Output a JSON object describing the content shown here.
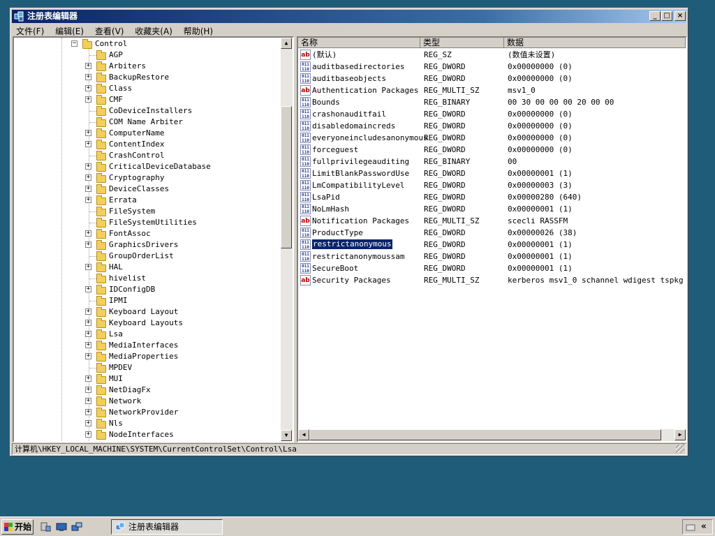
{
  "window": {
    "title": "注册表编辑器",
    "controls": {
      "minimize": "_",
      "maximize": "□",
      "close": "×"
    }
  },
  "menu": [
    "文件(F)",
    "编辑(E)",
    "查看(V)",
    "收藏夹(A)",
    "帮助(H)"
  ],
  "tree": {
    "parent": {
      "label": "Control",
      "expanded": true
    },
    "children": [
      {
        "label": "AGP",
        "expandable": false
      },
      {
        "label": "Arbiters",
        "expandable": true
      },
      {
        "label": "BackupRestore",
        "expandable": true
      },
      {
        "label": "Class",
        "expandable": true
      },
      {
        "label": "CMF",
        "expandable": true
      },
      {
        "label": "CoDeviceInstallers",
        "expandable": false
      },
      {
        "label": "COM Name Arbiter",
        "expandable": false
      },
      {
        "label": "ComputerName",
        "expandable": true
      },
      {
        "label": "ContentIndex",
        "expandable": true
      },
      {
        "label": "CrashControl",
        "expandable": false
      },
      {
        "label": "CriticalDeviceDatabase",
        "expandable": true
      },
      {
        "label": "Cryptography",
        "expandable": true
      },
      {
        "label": "DeviceClasses",
        "expandable": true
      },
      {
        "label": "Errata",
        "expandable": true
      },
      {
        "label": "FileSystem",
        "expandable": false
      },
      {
        "label": "FileSystemUtilities",
        "expandable": false
      },
      {
        "label": "FontAssoc",
        "expandable": true
      },
      {
        "label": "GraphicsDrivers",
        "expandable": true
      },
      {
        "label": "GroupOrderList",
        "expandable": false
      },
      {
        "label": "HAL",
        "expandable": true
      },
      {
        "label": "hivelist",
        "expandable": false
      },
      {
        "label": "IDConfigDB",
        "expandable": true
      },
      {
        "label": "IPMI",
        "expandable": false
      },
      {
        "label": "Keyboard Layout",
        "expandable": true
      },
      {
        "label": "Keyboard Layouts",
        "expandable": true
      },
      {
        "label": "Lsa",
        "expandable": true
      },
      {
        "label": "MediaInterfaces",
        "expandable": true
      },
      {
        "label": "MediaProperties",
        "expandable": true
      },
      {
        "label": "MPDEV",
        "expandable": false
      },
      {
        "label": "MUI",
        "expandable": true
      },
      {
        "label": "NetDiagFx",
        "expandable": true
      },
      {
        "label": "Network",
        "expandable": true
      },
      {
        "label": "NetworkProvider",
        "expandable": true
      },
      {
        "label": "Nls",
        "expandable": true
      },
      {
        "label": "NodeInterfaces",
        "expandable": true
      }
    ]
  },
  "list": {
    "columns": [
      "名称",
      "类型",
      "数据"
    ],
    "rows": [
      {
        "icon": "sz",
        "name": "(默认)",
        "type": "REG_SZ",
        "data": "(数值未设置)"
      },
      {
        "icon": "bin",
        "name": "auditbasedirectories",
        "type": "REG_DWORD",
        "data": "0x00000000 (0)"
      },
      {
        "icon": "bin",
        "name": "auditbaseobjects",
        "type": "REG_DWORD",
        "data": "0x00000000 (0)"
      },
      {
        "icon": "sz",
        "name": "Authentication Packages",
        "type": "REG_MULTI_SZ",
        "data": "msv1_0"
      },
      {
        "icon": "bin",
        "name": "Bounds",
        "type": "REG_BINARY",
        "data": "00 30 00 00 00 20 00 00"
      },
      {
        "icon": "bin",
        "name": "crashonauditfail",
        "type": "REG_DWORD",
        "data": "0x00000000 (0)"
      },
      {
        "icon": "bin",
        "name": "disabledomaincreds",
        "type": "REG_DWORD",
        "data": "0x00000000 (0)"
      },
      {
        "icon": "bin",
        "name": "everyoneincludesanonymous",
        "type": "REG_DWORD",
        "data": "0x00000000 (0)"
      },
      {
        "icon": "bin",
        "name": "forceguest",
        "type": "REG_DWORD",
        "data": "0x00000000 (0)"
      },
      {
        "icon": "bin",
        "name": "fullprivilegeauditing",
        "type": "REG_BINARY",
        "data": "00"
      },
      {
        "icon": "bin",
        "name": "LimitBlankPasswordUse",
        "type": "REG_DWORD",
        "data": "0x00000001 (1)"
      },
      {
        "icon": "bin",
        "name": "LmCompatibilityLevel",
        "type": "REG_DWORD",
        "data": "0x00000003 (3)"
      },
      {
        "icon": "bin",
        "name": "LsaPid",
        "type": "REG_DWORD",
        "data": "0x00000280 (640)"
      },
      {
        "icon": "bin",
        "name": "NoLmHash",
        "type": "REG_DWORD",
        "data": "0x00000001 (1)"
      },
      {
        "icon": "sz",
        "name": "Notification Packages",
        "type": "REG_MULTI_SZ",
        "data": "scecli RASSFM"
      },
      {
        "icon": "bin",
        "name": "ProductType",
        "type": "REG_DWORD",
        "data": "0x00000026 (38)"
      },
      {
        "icon": "bin",
        "name": "restrictanonymous",
        "type": "REG_DWORD",
        "data": "0x00000001 (1)",
        "selected": true
      },
      {
        "icon": "bin",
        "name": "restrictanonymoussam",
        "type": "REG_DWORD",
        "data": "0x00000001 (1)"
      },
      {
        "icon": "bin",
        "name": "SecureBoot",
        "type": "REG_DWORD",
        "data": "0x00000001 (1)"
      },
      {
        "icon": "sz",
        "name": "Security Packages",
        "type": "REG_MULTI_SZ",
        "data": "kerberos msv1_0 schannel wdigest tspkg"
      }
    ]
  },
  "status": "计算机\\HKEY_LOCAL_MACHINE\\SYSTEM\\CurrentControlSet\\Control\\Lsa",
  "taskbar": {
    "start_label": "开始",
    "task_label": "注册表编辑器",
    "tray_toggle": "«"
  },
  "icon_text": {
    "sz": "ab",
    "bin": "011\n110"
  },
  "colors": {
    "desktop": "#1f5c7a",
    "titlebar": "#0a246a",
    "selection": "#0a246a",
    "face": "#d4d0c8"
  }
}
